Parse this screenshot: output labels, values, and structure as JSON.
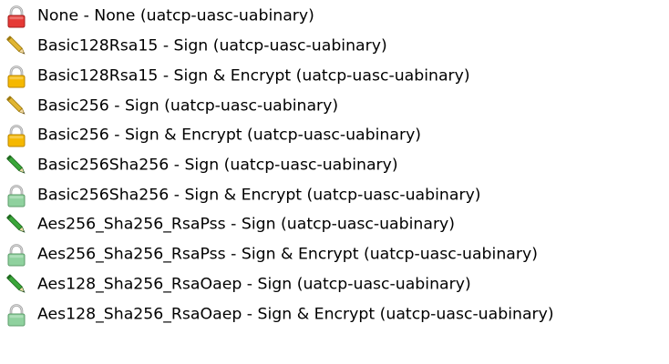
{
  "endpoints": [
    {
      "label": "None - None (uatcp-uasc-uabinary)",
      "icon": "red-lock-icon",
      "color": "#e53935"
    },
    {
      "label": "Basic128Rsa15 - Sign (uatcp-uasc-uabinary)",
      "icon": "yellow-pencil-icon",
      "color": "#e0b534"
    },
    {
      "label": "Basic128Rsa15 - Sign & Encrypt (uatcp-uasc-uabinary)",
      "icon": "yellow-lock-icon",
      "color": "#f5b800"
    },
    {
      "label": "Basic256 - Sign (uatcp-uasc-uabinary)",
      "icon": "yellow-pencil-icon",
      "color": "#e0b534"
    },
    {
      "label": "Basic256 - Sign & Encrypt (uatcp-uasc-uabinary)",
      "icon": "yellow-lock-icon",
      "color": "#f5b800"
    },
    {
      "label": "Basic256Sha256 - Sign (uatcp-uasc-uabinary)",
      "icon": "green-pencil-icon",
      "color": "#3aa63a"
    },
    {
      "label": "Basic256Sha256 - Sign & Encrypt (uatcp-uasc-uabinary)",
      "icon": "green-lock-icon",
      "color": "#8fd19e"
    },
    {
      "label": "Aes256_Sha256_RsaPss - Sign (uatcp-uasc-uabinary)",
      "icon": "green-pencil-icon",
      "color": "#3aa63a"
    },
    {
      "label": "Aes256_Sha256_RsaPss - Sign & Encrypt (uatcp-uasc-uabinary)",
      "icon": "green-lock-icon",
      "color": "#8fd19e"
    },
    {
      "label": "Aes128_Sha256_RsaOaep - Sign (uatcp-uasc-uabinary)",
      "icon": "green-pencil-icon",
      "color": "#3aa63a"
    },
    {
      "label": "Aes128_Sha256_RsaOaep - Sign & Encrypt (uatcp-uasc-uabinary)",
      "icon": "green-lock-icon",
      "color": "#8fd19e"
    }
  ]
}
